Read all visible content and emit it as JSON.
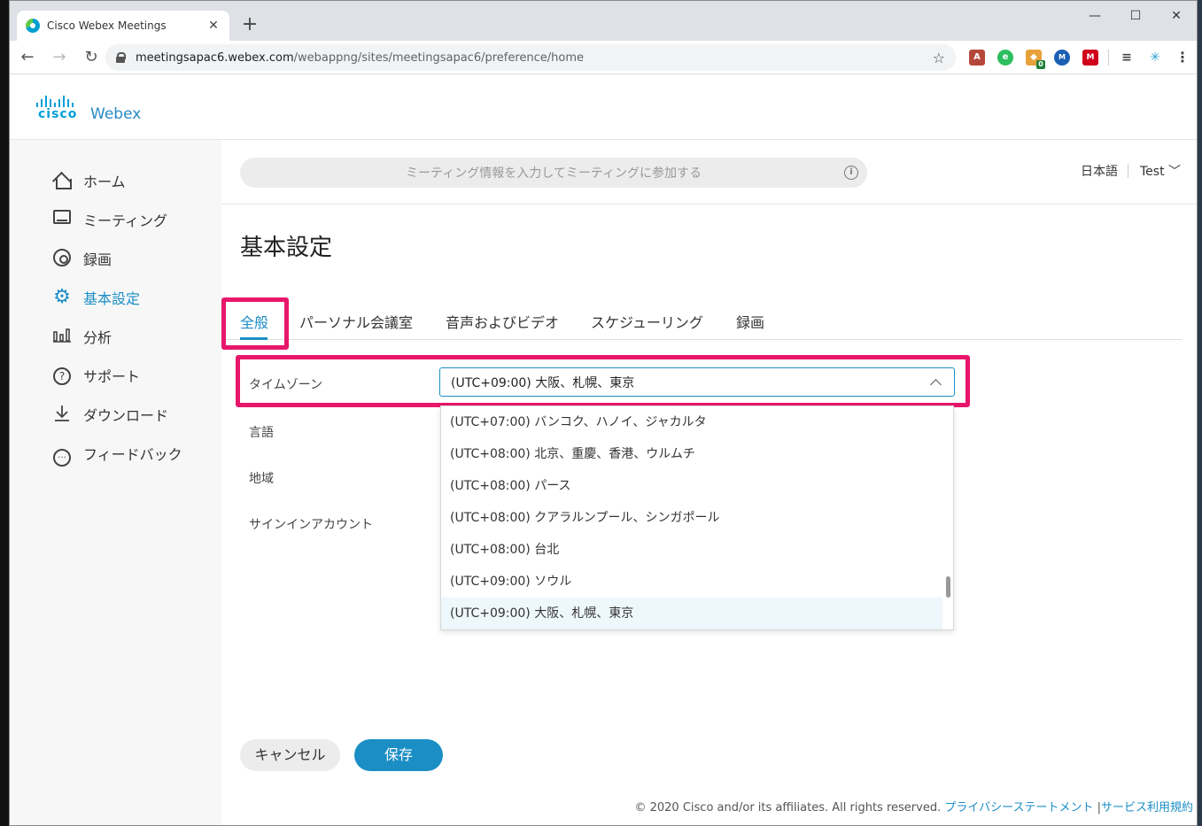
{
  "browser": {
    "tab_title": "Cisco Webex Meetings",
    "tab_close": "✕",
    "new_tab": "+",
    "url_host": "meetingsapac6.webex.com",
    "url_path": "/webappng/sites/meetingsapac6/preference/home",
    "window_controls": {
      "minimize": "—",
      "maximize": "☐",
      "close": "✕"
    },
    "extension_badge": "0"
  },
  "logo": {
    "brand": "cisco",
    "product": "Webex"
  },
  "header": {
    "search_placeholder": "ミーティング情報を入力してミーティングに参加する",
    "language": "日本語",
    "user": "Test"
  },
  "sidebar": {
    "items": [
      {
        "label": "ホーム",
        "icon": "home-icon"
      },
      {
        "label": "ミーティング",
        "icon": "meeting-icon"
      },
      {
        "label": "録画",
        "icon": "recording-icon"
      },
      {
        "label": "基本設定",
        "icon": "gear-icon",
        "active": true
      },
      {
        "label": "分析",
        "icon": "bar-chart-icon"
      },
      {
        "label": "サポート",
        "icon": "help-icon"
      },
      {
        "label": "ダウンロード",
        "icon": "download-icon"
      },
      {
        "label": "フィードバック",
        "icon": "feedback-icon"
      }
    ]
  },
  "main": {
    "title": "基本設定",
    "tabs": [
      "全般",
      "パーソナル会議室",
      "音声およびビデオ",
      "スケジューリング",
      "録画"
    ],
    "active_tab": "全般",
    "form": {
      "timezone_label": "タイムゾーン",
      "language_label": "言語",
      "region_label": "地域",
      "signin_label": "サインインアカウント",
      "timezone_value": "(UTC+09:00) 大阪、札幌、東京"
    },
    "dropdown_options": [
      "(UTC+07:00) バンコク、ハノイ、ジャカルタ",
      "(UTC+08:00) 北京、重慶、香港、ウルムチ",
      "(UTC+08:00) パース",
      "(UTC+08:00) クアラルンプール、シンガポール",
      "(UTC+08:00) 台北",
      "(UTC+09:00) ソウル",
      "(UTC+09:00) 大阪、札幌、東京"
    ],
    "cancel_label": "キャンセル",
    "save_label": "保存"
  },
  "footer": {
    "copyright": "© 2020 Cisco and/or its affiliates. All rights reserved.",
    "privacy": "プライバシーステートメント",
    "separator": "|",
    "terms": "サービス利用規約"
  },
  "colors": {
    "accent": "#1b8ec5",
    "highlight": "#e8176b"
  }
}
